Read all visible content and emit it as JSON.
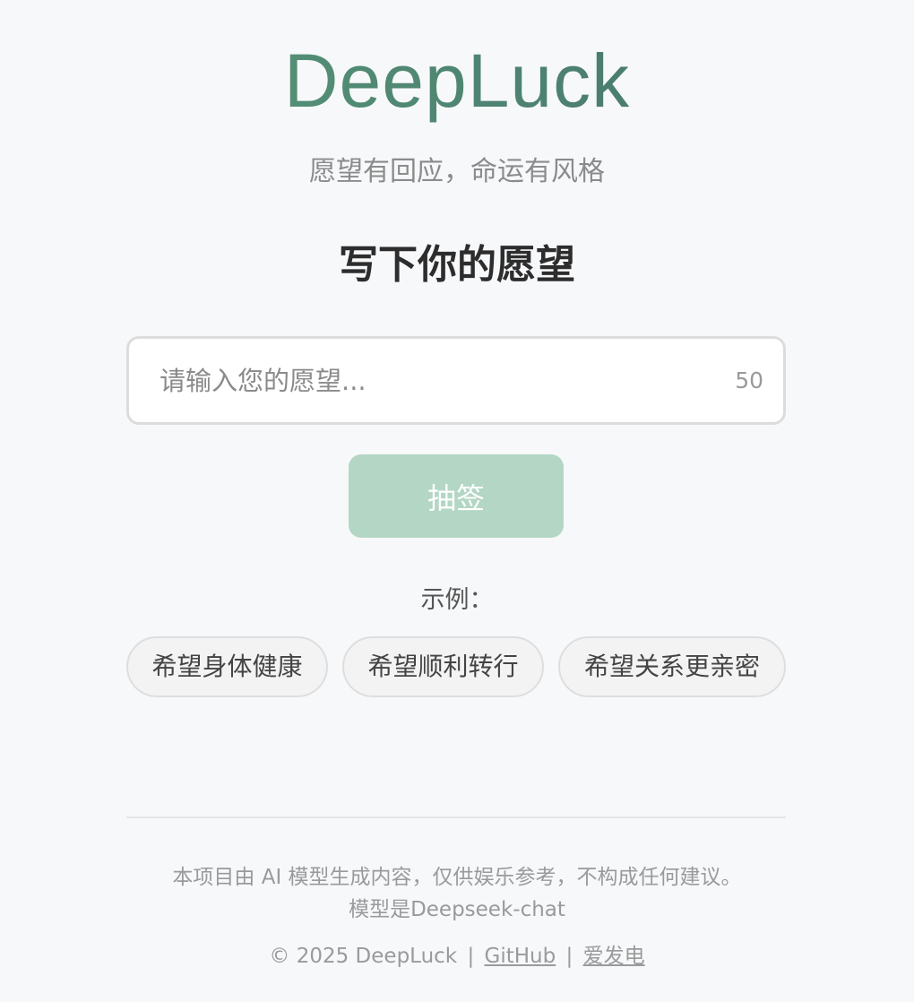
{
  "brand": {
    "title": "DeepLuck",
    "tagline": "愿望有回应，命运有风格"
  },
  "form": {
    "heading": "写下你的愿望",
    "placeholder": "请输入您的愿望...",
    "value": "",
    "max_length": "50",
    "submit_label": "抽签"
  },
  "examples": {
    "label": "示例：",
    "items": [
      "希望身体健康",
      "希望顺利转行",
      "希望关系更亲密"
    ]
  },
  "footer": {
    "disclaimer": "本项目由 AI 模型生成内容，仅供娱乐参考，不构成任何建议。",
    "model_note": "模型是Deepseek-chat",
    "copyright": "© 2025 DeepLuck",
    "separator": "|",
    "github_label": "GitHub",
    "author_label": "爱发电"
  },
  "colors": {
    "accent": "#5c9b7a",
    "button_bg": "#b3d6c5",
    "background": "#f7f8fa"
  }
}
